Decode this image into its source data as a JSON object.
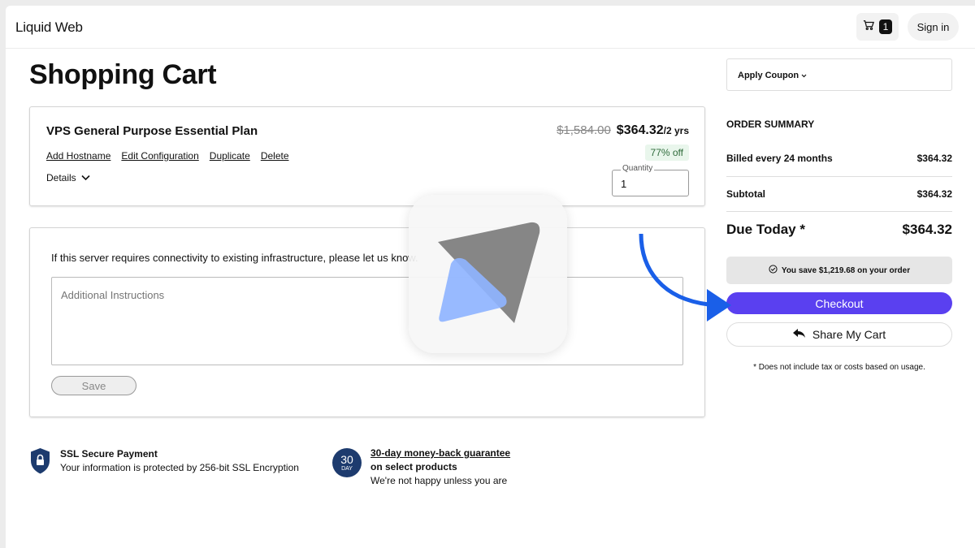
{
  "header": {
    "brand": "Liquid Web",
    "cart_count": "1",
    "signin_label": "Sign in"
  },
  "page_title": "Shopping Cart",
  "cart_item": {
    "name": "VPS General Purpose Essential Plan",
    "actions": [
      "Add Hostname",
      "Edit Configuration",
      "Duplicate",
      "Delete"
    ],
    "details_label": "Details",
    "old_price": "$1,584.00",
    "price": "$364.32",
    "term": "/2 yrs",
    "discount": "77% off",
    "quantity_label": "Quantity",
    "quantity_value": "1"
  },
  "instructions": {
    "prompt": "If this server requires connectivity to existing infrastructure, please let us know.",
    "placeholder": "Additional Instructions",
    "save_label": "Save"
  },
  "trust": {
    "ssl_title": "SSL Secure Payment",
    "ssl_desc": "Your information is protected by 256-bit SSL Encryption",
    "badge_num": "30",
    "badge_unit": "DAY",
    "money_title": "30-day money-back guarantee",
    "money_sub": "on select products",
    "money_desc": "We're not happy unless you are"
  },
  "summary": {
    "coupon_label": "Apply Coupon",
    "title": "ORDER SUMMARY",
    "billed_label": "Billed every 24 months",
    "billed_value": "$364.32",
    "subtotal_label": "Subtotal",
    "subtotal_value": "$364.32",
    "due_label": "Due Today *",
    "due_value": "$364.32",
    "savings_text": "You save $1,219.68 on your order",
    "checkout_label": "Checkout",
    "share_label": "Share My Cart",
    "footnote": "* Does not include tax or costs based on usage."
  },
  "colors": {
    "checkout": "#5a40f0",
    "annotation_arrow": "#1a5fe8",
    "discount_bg": "#e9f6ec"
  }
}
